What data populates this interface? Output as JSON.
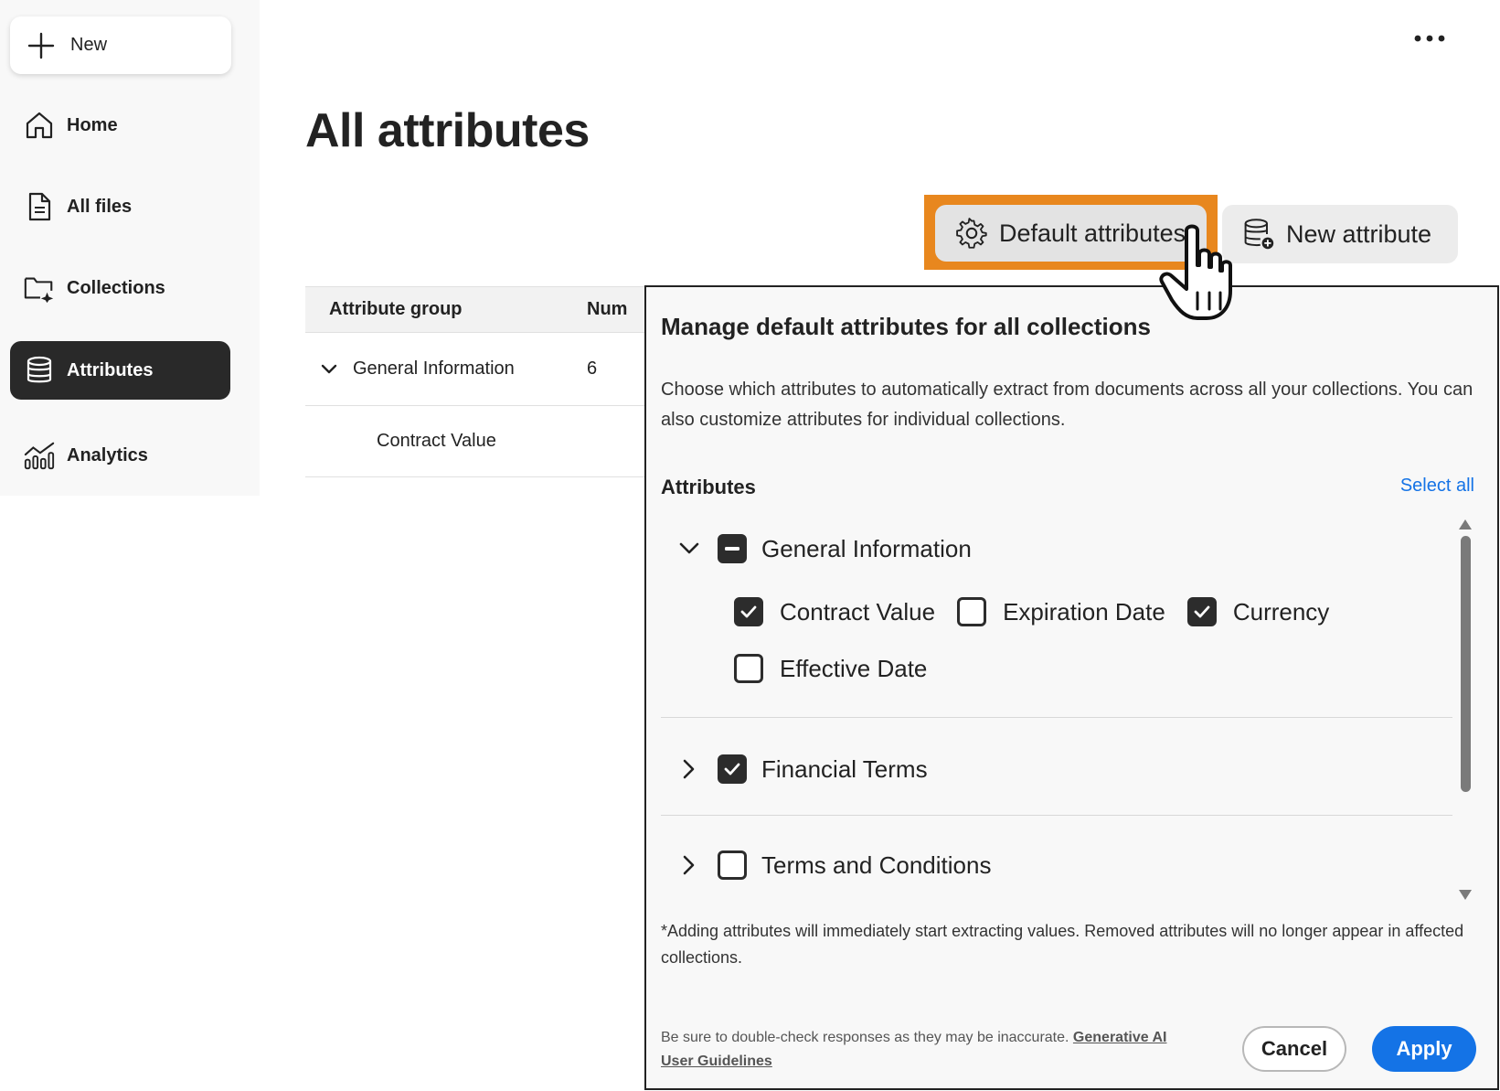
{
  "sidebar": {
    "new_label": "New",
    "items": [
      {
        "label": "Home",
        "icon": "home-icon",
        "active": false
      },
      {
        "label": "All files",
        "icon": "file-icon",
        "active": false
      },
      {
        "label": "Collections",
        "icon": "folder-icon",
        "active": false
      },
      {
        "label": "Attributes",
        "icon": "database-icon",
        "active": true
      },
      {
        "label": "Analytics",
        "icon": "analytics-icon",
        "active": false
      }
    ]
  },
  "header": {
    "more_icon": "more-icon",
    "title": "All attributes",
    "default_attributes_label": "Default attributes",
    "new_attribute_label": "New attribute"
  },
  "table": {
    "col_group": "Attribute group",
    "col_number": "Num",
    "rows": [
      {
        "label": "General Information",
        "count": "6"
      },
      {
        "label": "Contract Value",
        "count": ""
      }
    ]
  },
  "popover": {
    "title": "Manage default attributes for all collections",
    "description": "Choose which attributes to automatically extract from documents across all your collections. You can also customize attributes for individual collections.",
    "attributes_heading": "Attributes",
    "select_all": "Select all",
    "groups": [
      {
        "label": "General Information",
        "state": "indeterminate",
        "expanded": true,
        "children": [
          {
            "label": "Contract Value",
            "checked": true
          },
          {
            "label": "Expiration Date",
            "checked": false
          },
          {
            "label": "Currency",
            "checked": true
          },
          {
            "label": "Effective Date",
            "checked": false
          }
        ]
      },
      {
        "label": "Financial Terms",
        "state": "checked",
        "expanded": false
      },
      {
        "label": "Terms and Conditions",
        "state": "unchecked",
        "expanded": false
      }
    ],
    "note": "*Adding attributes will immediately start extracting values. Removed attributes will no longer appear in affected collections.",
    "disclaimer": "Be sure to double-check responses as they may be inaccurate.",
    "guidelines_link": "Generative AI User Guidelines",
    "cancel": "Cancel",
    "apply": "Apply"
  },
  "colors": {
    "accent_blue": "#1473e6",
    "highlight_orange": "#e8871e",
    "active_nav": "#292929"
  }
}
